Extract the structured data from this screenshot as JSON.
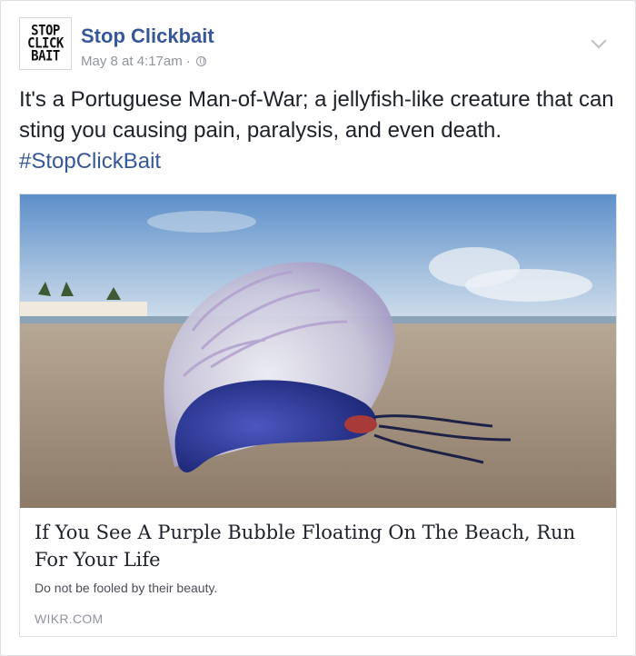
{
  "page": {
    "name": "Stop Clickbait",
    "avatar_lines": [
      "STOP",
      "CLICK",
      "BAIT"
    ]
  },
  "meta": {
    "timestamp": "May 8 at 4:17am",
    "separator": "·",
    "audience_icon": "globe-icon"
  },
  "post": {
    "text": "It's a Portuguese Man-of-War; a jellyfish-like creature that can sting you causing pain, paralysis, and even death.",
    "hashtag": "#StopClickBait"
  },
  "link_card": {
    "title": "If You See A Purple Bubble Floating On The Beach, Run For Your Life",
    "description": "Do not be fooled by their beauty.",
    "domain": "WIKR.COM"
  },
  "colors": {
    "link": "#365899",
    "text": "#1d2129",
    "muted": "#90949c"
  }
}
